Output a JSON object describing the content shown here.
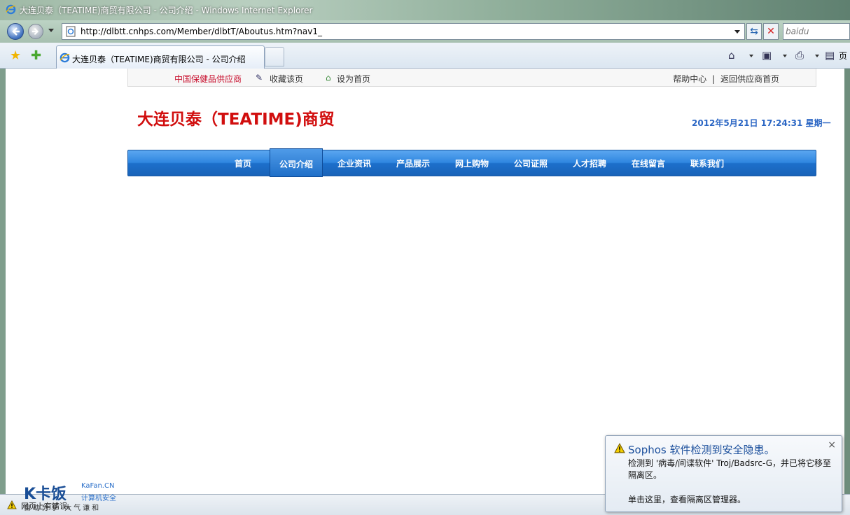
{
  "window": {
    "title": "大连贝泰（TEATIME)商贸有限公司 - 公司介绍 - Windows Internet Explorer"
  },
  "address": {
    "url": "http://dlbtt.cnhps.com/Member/dlbtT/Aboutus.htm?nav1_",
    "search_placeholder": "baidu"
  },
  "tabs": {
    "active_label": "大连贝泰（TEATIME)商贸有限公司 - 公司介绍",
    "page_menu": "页"
  },
  "site": {
    "topbar": {
      "supplier": "中国保健品供应商",
      "bookmark": "收藏该页",
      "set_home": "设为首页",
      "help": "帮助中心",
      "separator": "|",
      "back_home": "返回供应商首页"
    },
    "title": "大连贝泰（TEATIME)商贸",
    "datetime": "2012年5月21日 17:24:31 星期一",
    "nav": [
      {
        "label": "首页"
      },
      {
        "label": "公司介绍"
      },
      {
        "label": "企业资讯"
      },
      {
        "label": "产品展示"
      },
      {
        "label": "网上购物"
      },
      {
        "label": "公司证照"
      },
      {
        "label": "人才招聘"
      },
      {
        "label": "在线留言"
      },
      {
        "label": "联系我们"
      }
    ],
    "nav_active_index": 1
  },
  "popup": {
    "title": "Sophos 软件检测到安全隐患。",
    "body": "检测到 '病毒/间谍软件' Troj/Badsrc-G，并已将它移至隔离区。",
    "link": "单击这里，查看隔离区管理器。",
    "close": "×"
  },
  "statusbar": {
    "text": "网页上有错误。"
  },
  "watermark": {
    "logo": "K卡饭",
    "site": "KaFan.CN",
    "cn": "计算机安全",
    "slogan": "自助分享 大气谦和"
  },
  "colors": {
    "site_title": "#d10e0e",
    "datetime": "#2b66c4",
    "nav_bg": "#2f86e0",
    "supplier": "#c8102e"
  }
}
